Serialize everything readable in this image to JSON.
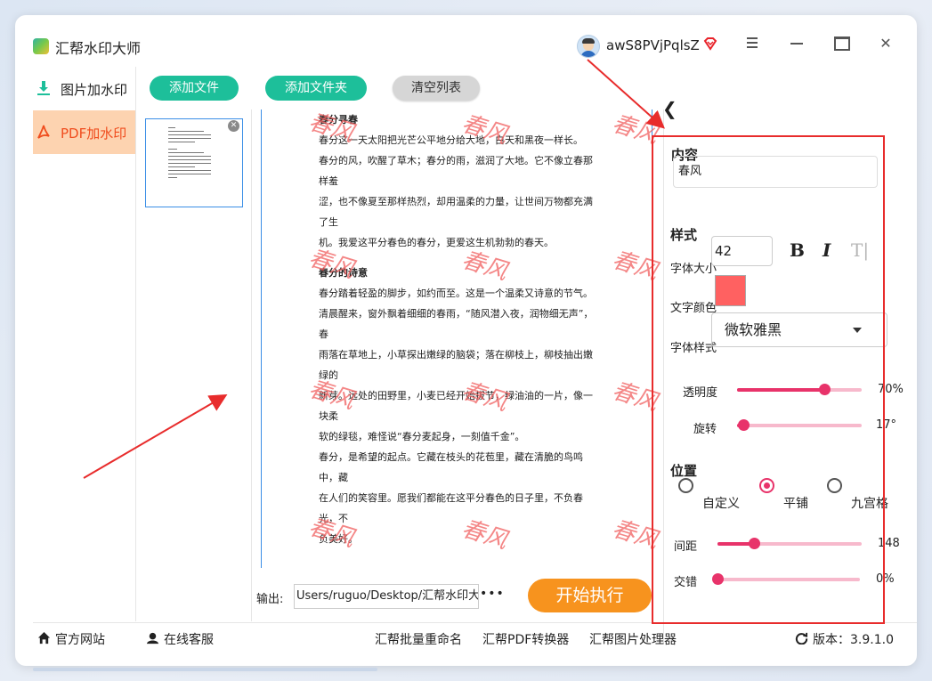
{
  "app": {
    "title": "汇帮水印大师",
    "username": "awS8PVjPqlsZ"
  },
  "sidebar": {
    "items": [
      {
        "label": "图片加水印"
      },
      {
        "label": "PDF加水印"
      }
    ]
  },
  "toolbar": {
    "add_file": "添加文件",
    "add_folder": "添加文件夹",
    "clear_list": "清空列表"
  },
  "preview": {
    "watermark_text": "春风",
    "doc": [
      {
        "type": "heading",
        "text": "春分寻春"
      },
      {
        "type": "p",
        "text": "春分这一天太阳把光芒公平地分给大地，白天和黑夜一样长。"
      },
      {
        "type": "p",
        "text": "春分的风，吹醒了草木；春分的雨，滋润了大地。它不像立春那样羞"
      },
      {
        "type": "p",
        "text": "涩，也不像夏至那样热烈，却用温柔的力量，让世间万物都充满了生"
      },
      {
        "type": "p",
        "text": "机。我爱这平分春色的春分，更爱这生机勃勃的春天。"
      },
      {
        "type": "gap",
        "text": ""
      },
      {
        "type": "heading",
        "text": "春分的诗意"
      },
      {
        "type": "p",
        "text": "春分踏着轻盈的脚步，如约而至。这是一个温柔又诗意的节气。"
      },
      {
        "type": "p",
        "text": "清晨醒来，窗外飘着细细的春雨，“随风潜入夜，润物细无声”，春"
      },
      {
        "type": "p",
        "text": "雨落在草地上，小草探出嫩绿的脑袋；落在柳枝上，柳枝抽出嫩绿的"
      },
      {
        "type": "p",
        "text": "新芽。远处的田野里，小麦已经开始拔节，绿油油的一片，像一块柔"
      },
      {
        "type": "p",
        "text": "软的绿毯，难怪说“春分麦起身，一刻值千金”。"
      },
      {
        "type": "p",
        "text": "春分，是希望的起点。它藏在枝头的花苞里，藏在清脆的鸟鸣中，藏"
      },
      {
        "type": "p",
        "text": "在人们的笑容里。愿我们都能在这平分春色的日子里，不负春光，不"
      },
      {
        "type": "p",
        "text": "负美好。"
      }
    ]
  },
  "output": {
    "label": "输出:",
    "path": "Users/ruguo/Desktop/汇帮水印大师",
    "more": "•••",
    "start": "开始执行"
  },
  "panel": {
    "content_title": "内容",
    "content_value": "春风",
    "style_title": "样式",
    "font_size_label": "字体大小",
    "font_size": "42",
    "bold": "B",
    "italic": "I",
    "clear_format": "T|",
    "text_color_label": "文字颜色",
    "text_color": "#ff6161",
    "font_style_label": "字体样式",
    "font_style": "微软雅黑",
    "opacity_label": "透明度",
    "opacity_value": "70%",
    "opacity": 0.7,
    "rotate_label": "旋转",
    "rotate_value": "17°",
    "rotate": 0.047,
    "position_title": "位置",
    "position_options": [
      "自定义",
      "平铺",
      "九宫格"
    ],
    "position_selected": "平铺",
    "spacing_label": "间距",
    "spacing_value": "148",
    "spacing": 0.25,
    "stagger_label": "交错",
    "stagger_value": "0%",
    "stagger": 0
  },
  "footer": {
    "website": "官方网站",
    "support": "在线客服",
    "rename": "汇帮批量重命名",
    "pdf_converter": "汇帮PDF转换器",
    "image_processor": "汇帮图片处理器",
    "version": "版本：3.9.1.0"
  },
  "colors": {
    "accent_green": "#1dbf9a",
    "accent_orange": "#f7931e",
    "accent_pink": "#e8336a",
    "annotation_red": "#e82c2c"
  },
  "icons": [
    "app-logo-icon",
    "avatar-icon",
    "vip-diamond-icon",
    "menu-icon",
    "minimize-icon",
    "maximize-icon",
    "close-icon",
    "download-icon",
    "pdf-icon",
    "back-arrow-icon",
    "home-icon",
    "headset-icon",
    "refresh-icon"
  ]
}
